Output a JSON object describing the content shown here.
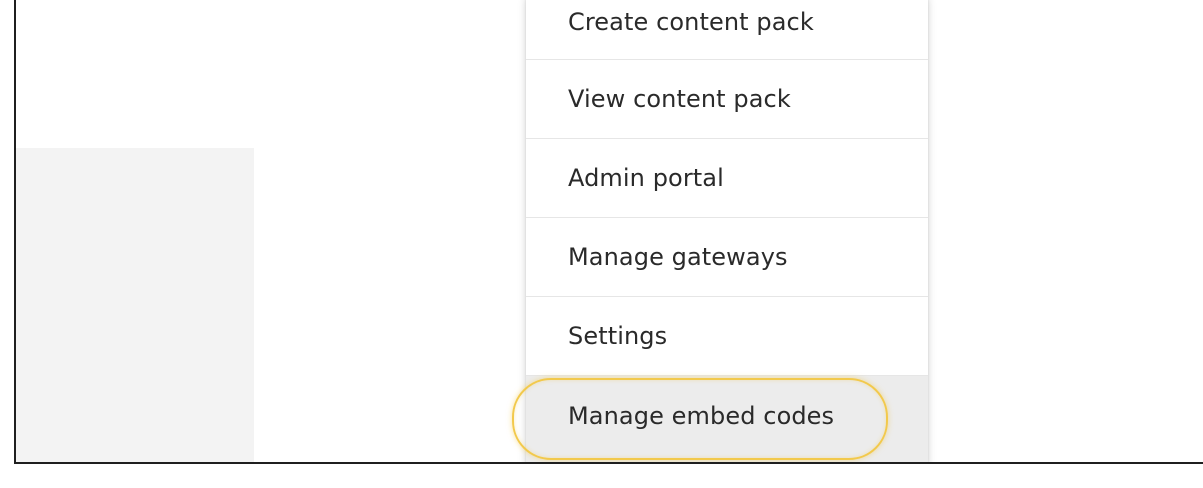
{
  "menu": {
    "items": [
      {
        "label": "Create content pack"
      },
      {
        "label": "View content pack"
      },
      {
        "label": "Admin portal"
      },
      {
        "label": "Manage gateways"
      },
      {
        "label": "Settings"
      },
      {
        "label": "Manage embed codes"
      }
    ],
    "highlighted_index": 5
  },
  "colors": {
    "highlight_ring": "#f2c94c",
    "hover_background": "#ececec",
    "side_panel": "#f3f3f3",
    "frame_border": "#1f1f1f",
    "text": "#2a2a2a"
  }
}
